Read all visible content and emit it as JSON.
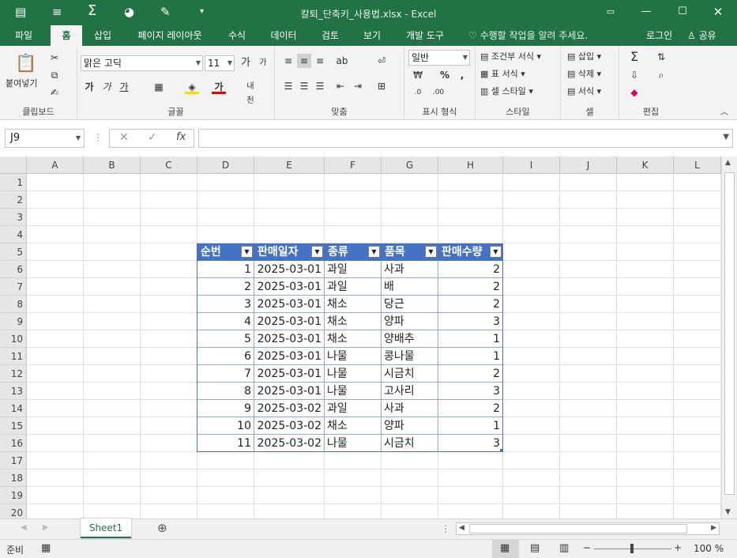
{
  "title_bar": {
    "title": "칼퇴_단축키_사용법.xlsx - Excel",
    "quick_access": [
      "save-icon",
      "menu-icon",
      "sum-icon",
      "chart-icon",
      "brush-icon",
      "more-icon"
    ]
  },
  "tabs": [
    "파일",
    "홈",
    "삽입",
    "페이지 레이아웃",
    "수식",
    "데이터",
    "검토",
    "보기",
    "개발 도구"
  ],
  "active_tab": "홈",
  "tell_me": "수행할 작업을 알려 주세요.",
  "login": "로그인",
  "share": "공유",
  "ribbon": {
    "clipboard": {
      "paste": "붙여넣기",
      "label": "클립보드"
    },
    "font": {
      "name": "맑은 고딕",
      "size": "11",
      "bold": "가",
      "italic": "가",
      "underline": "가",
      "label": "글꼴"
    },
    "alignment": {
      "label": "맞춤"
    },
    "number": {
      "format": "일반",
      "percent": "%",
      "comma": ",",
      "label": "표시 형식"
    },
    "styles": {
      "conditional": "조건부 서식",
      "table": "표 서식",
      "cell_style": "셀 스타일",
      "label": "스타일"
    },
    "cells": {
      "insert": "삽입",
      "delete": "삭제",
      "format": "서식",
      "label": "셀"
    },
    "editing": {
      "label": "편집"
    }
  },
  "formula_bar": {
    "name_box": "J9",
    "fx": "fx",
    "formula": ""
  },
  "columns": [
    "A",
    "B",
    "C",
    "D",
    "E",
    "F",
    "G",
    "H",
    "I",
    "J",
    "K",
    "L"
  ],
  "rows": [
    "1",
    "2",
    "3",
    "4",
    "5",
    "6",
    "7",
    "8",
    "9",
    "10",
    "11",
    "12",
    "13",
    "14",
    "15",
    "16",
    "17",
    "18",
    "19",
    "20"
  ],
  "table": {
    "headers": [
      "순번",
      "판매일자",
      "종류",
      "품목",
      "판매수량"
    ],
    "rows": [
      [
        "1",
        "2025-03-01",
        "과일",
        "사과",
        "2"
      ],
      [
        "2",
        "2025-03-01",
        "과일",
        "배",
        "2"
      ],
      [
        "3",
        "2025-03-01",
        "채소",
        "당근",
        "2"
      ],
      [
        "4",
        "2025-03-01",
        "채소",
        "양파",
        "3"
      ],
      [
        "5",
        "2025-03-01",
        "채소",
        "양배추",
        "1"
      ],
      [
        "6",
        "2025-03-01",
        "나물",
        "콩나물",
        "1"
      ],
      [
        "7",
        "2025-03-01",
        "나물",
        "시금치",
        "2"
      ],
      [
        "8",
        "2025-03-01",
        "나물",
        "고사리",
        "3"
      ],
      [
        "9",
        "2025-03-02",
        "과일",
        "사과",
        "2"
      ],
      [
        "10",
        "2025-03-02",
        "채소",
        "양파",
        "1"
      ],
      [
        "11",
        "2025-03-02",
        "나물",
        "시금치",
        "3"
      ]
    ]
  },
  "sheet_tab": "Sheet1",
  "status": {
    "ready": "준비",
    "zoom": "100 %"
  },
  "colors": {
    "excel_green": "#217346",
    "table_header": "#4472c4",
    "table_border": "#8ea9db"
  }
}
